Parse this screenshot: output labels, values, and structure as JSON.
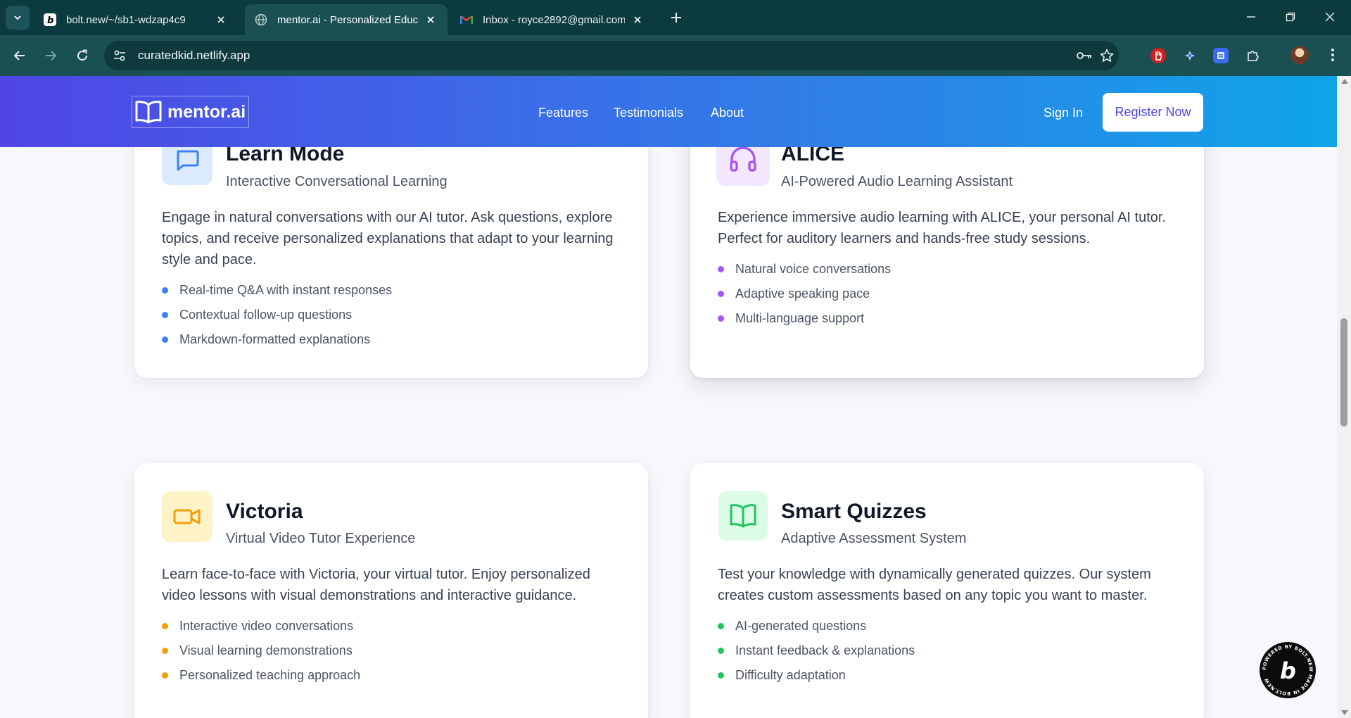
{
  "browser": {
    "tabs": [
      {
        "title": "bolt.new/~/sb1-wdzap4c9",
        "favicon": "bolt-icon",
        "active": false
      },
      {
        "title": "mentor.ai - Personalized Educat",
        "favicon": "globe-icon",
        "active": true
      },
      {
        "title": "Inbox - royce2892@gmail.com",
        "favicon": "gmail-icon",
        "active": false
      }
    ],
    "url": "curatedkid.netlify.app"
  },
  "site": {
    "logo": "mentor.ai",
    "nav": [
      "Features",
      "Testimonials",
      "About"
    ],
    "sign_in": "Sign In",
    "register": "Register Now"
  },
  "features": [
    {
      "title": "Learn Mode",
      "subtitle": "Interactive Conversational Learning",
      "icon": "chat-icon",
      "accent": "#3b82f6",
      "icon_bg": "#dbeafe",
      "description": "Engage in natural conversations with our AI tutor. Ask questions, explore topics, and receive personalized explanations that adapt to your learning style and pace.",
      "bullets": [
        "Real-time Q&A with instant responses",
        "Contextual follow-up questions",
        "Markdown-formatted explanations"
      ]
    },
    {
      "title": "ALICE",
      "subtitle": "AI-Powered Audio Learning Assistant",
      "icon": "headphones-icon",
      "accent": "#a855f7",
      "icon_bg": "#f3e8ff",
      "description": "Experience immersive audio learning with ALICE, your personal AI tutor. Perfect for auditory learners and hands-free study sessions.",
      "bullets": [
        "Natural voice conversations",
        "Adaptive speaking pace",
        "Multi-language support"
      ]
    },
    {
      "title": "Victoria",
      "subtitle": "Virtual Video Tutor Experience",
      "icon": "video-camera-icon",
      "accent": "#f59e0b",
      "icon_bg": "#fef3c7",
      "description": "Learn face-to-face with Victoria, your virtual tutor. Enjoy personalized video lessons with visual demonstrations and interactive guidance.",
      "bullets": [
        "Interactive video conversations",
        "Visual learning demonstrations",
        "Personalized teaching approach"
      ]
    },
    {
      "title": "Smart Quizzes",
      "subtitle": "Adaptive Assessment System",
      "icon": "open-book-icon",
      "accent": "#22c55e",
      "icon_bg": "#dcfce7",
      "description": "Test your knowledge with dynamically generated quizzes. Our system creates custom assessments based on any topic you want to master.",
      "bullets": [
        "AI-generated questions",
        "Instant feedback & explanations",
        "Difficulty adaptation"
      ]
    }
  ],
  "badge": {
    "icon": "bolt-badge-icon",
    "text": "POWERED BY BOLT.NEW MADE IN BOLT.NEW"
  }
}
